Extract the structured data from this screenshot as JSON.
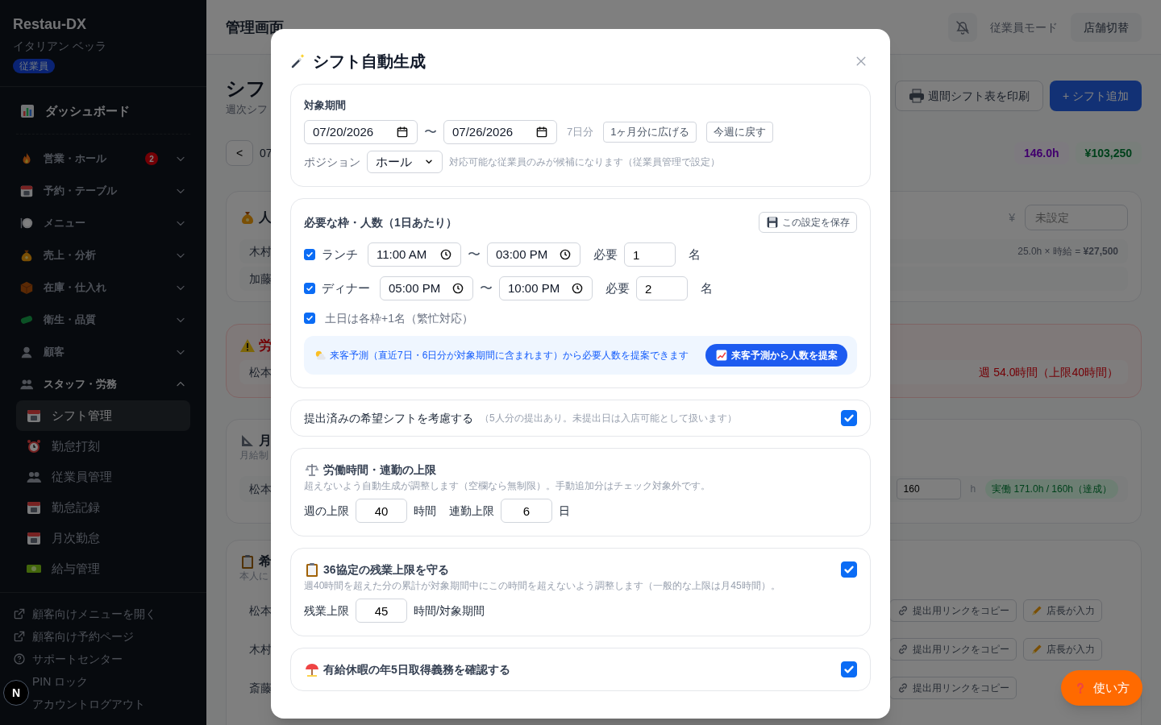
{
  "sidebar": {
    "brand": "Restau-DX",
    "store": "イタリアン ベッラ",
    "role_badge": "従業員",
    "dashboard": "ダッシュボード",
    "groups": [
      {
        "label": "営業・ホール",
        "badge": "2",
        "expanded": false
      },
      {
        "label": "予約・テーブル",
        "expanded": false
      },
      {
        "label": "メニュー",
        "expanded": false
      },
      {
        "label": "売上・分析",
        "expanded": false
      },
      {
        "label": "在庫・仕入れ",
        "expanded": false
      },
      {
        "label": "衛生・品質",
        "expanded": false
      },
      {
        "label": "顧客",
        "expanded": false
      },
      {
        "label": "スタッフ・労務",
        "expanded": true,
        "children": [
          {
            "label": "シフト管理",
            "selected": true
          },
          {
            "label": "勤怠打刻",
            "selected": false
          },
          {
            "label": "従業員管理",
            "selected": false
          },
          {
            "label": "勤怠記録",
            "selected": false
          },
          {
            "label": "月次勤怠",
            "selected": false
          },
          {
            "label": "給与管理",
            "selected": false
          }
        ]
      }
    ],
    "footer_links": [
      "顧客向けメニューを開く",
      "顧客向け予約ページ",
      "サポートセンター",
      "PIN ロック",
      "アカウントログアウト"
    ]
  },
  "background": {
    "header": {
      "title": "管理画面",
      "mode": "従業員モード",
      "store_switch": "店舗切替"
    },
    "page": {
      "title": "シフ",
      "subtitle": "週次シフ",
      "print_button": "週間シフト表を印刷",
      "add_button": "+ シフト追加",
      "prev_button": "<",
      "week": "07",
      "total_hours": "146.0h",
      "total_cost": "¥103,250"
    },
    "cards": [
      {
        "kind": "cost",
        "title": "人",
        "currency": "¥",
        "rate_placeholder": "未設定",
        "rows": [
          {
            "name": "木村",
            "detail": "25.0h × 時給 = **¥27,500**"
          },
          {
            "name": "加藤"
          }
        ]
      },
      {
        "kind": "alert",
        "title": "労",
        "rows": [
          {
            "name": "松本",
            "detail": "週 54.0時間（上限40時間）"
          }
        ]
      },
      {
        "kind": "monthly",
        "title": "月",
        "subtitle": "月給制",
        "rows": [
          {
            "name": "松本",
            "target": "160",
            "unit": "h",
            "result": "実働 171.0h / 160h（達成）"
          }
        ]
      },
      {
        "kind": "requests",
        "title": "希",
        "subtitle": "本人に",
        "rows": [
          {
            "name": "松本",
            "buttons": [
              "提出用リンクをコピー",
              "店長が入力"
            ]
          },
          {
            "name": "木村",
            "buttons": [
              "提出用リンクをコピー",
              "店長が入力"
            ]
          },
          {
            "name": "斎藤",
            "buttons": [
              "提出用リンクをコピー"
            ]
          }
        ]
      }
    ]
  },
  "modal": {
    "title": "シフト自動生成",
    "period": {
      "label": "対象期間",
      "start": "07/20/2026",
      "separator": "〜",
      "end": "07/26/2026",
      "days": "7日分",
      "buttons": [
        "1ヶ月分に広げる",
        "今週に戻す"
      ],
      "position_label": "ポジション",
      "position": "ホール",
      "position_note": "対応可能な従業員のみが候補になります（従業員管理で設定）"
    },
    "slots": {
      "title": "必要な枠・人数（1日あたり）",
      "save_button": "この設定を保存",
      "rows": [
        {
          "checked": true,
          "label": "ランチ",
          "start": "11:00 AM",
          "separator": "〜",
          "end": "03:00 PM",
          "need_label": "必要",
          "count": "1",
          "unit": "名"
        },
        {
          "checked": true,
          "label": "ディナー",
          "start": "05:00 PM",
          "separator": "〜",
          "end": "10:00 PM",
          "need_label": "必要",
          "count": "2",
          "unit": "名"
        }
      ],
      "weekend": {
        "checked": true,
        "label": "土日は各枠+1名（繁忙対応）"
      },
      "forecast": {
        "text": "来客予測（直近7日・6日分が対象期間に含まれます）から必要人数を提案できます",
        "button": "来客予測から人数を提案"
      }
    },
    "wishes": {
      "checked": true,
      "label": "提出済みの希望シフトを考慮する",
      "note": "（5人分の提出あり。未提出日は入店可能として扱います）"
    },
    "limits": {
      "title": "労働時間・連勤の上限",
      "description": "超えないよう自動生成が調整します（空欄なら無制限）。手動追加分はチェック対象外です。",
      "fields": [
        {
          "label": "週の上限",
          "value": "40",
          "unit": "時間"
        },
        {
          "label": "連勤上限",
          "value": "6",
          "unit": "日"
        }
      ]
    },
    "overtime": {
      "checked": true,
      "title": "36協定の残業上限を守る",
      "description": "週40時間を超えた分の累計が対象期間中にこの時間を超えないよう調整します（一般的な上限は月45時間）。",
      "fields": [
        {
          "label": "残業上限",
          "value": "45",
          "unit": "時間/対象期間"
        }
      ]
    },
    "paid_leave": {
      "checked": true,
      "title": "有給休暇の年5日取得義務を確認する"
    }
  },
  "help_button": "使い方",
  "dev_indicator": "N"
}
